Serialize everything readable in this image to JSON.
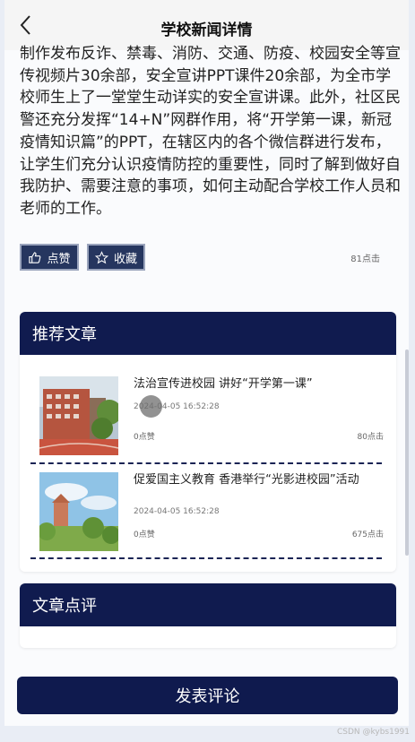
{
  "header": {
    "title": "学校新闻详情"
  },
  "article": {
    "body": "制作发布反诈、禁毒、消防、交通、防疫、校园安全等宣传视频片30余部，安全宣讲PPT课件20余部，为全市学校师生上了一堂堂生动详实的安全宣讲课。此外，社区民警还充分发挥“14+N”网群作用，将“开学第一课，新冠疫情知识篇”的PPT，在辖区内的各个微信群进行发布，让学生们充分认识疫情防控的重要性，同时了解到做好自我防护、需要注意的事项，如何主动配合学校工作人员和老师的工作。"
  },
  "actions": {
    "like_label": "点赞",
    "favorite_label": "收藏",
    "clicks": "81点击"
  },
  "recommended": {
    "heading": "推荐文章",
    "items": [
      {
        "title": "法治宣传进校园 讲好“开学第一课”",
        "date": "2024-04-05 16:52:28",
        "likes": "0点赞",
        "clicks": "80点击"
      },
      {
        "title": "促爱国主义教育 香港举行“光影进校园”活动",
        "date": "2024-04-05 16:52:28",
        "likes": "0点赞",
        "clicks": "675点击"
      }
    ]
  },
  "comments": {
    "heading": "文章点评"
  },
  "submit": {
    "label": "发表评论"
  },
  "watermark": "CSDN @kybs1991",
  "colors": {
    "header_bg": "#f5f5f5",
    "navy": "#101b4f",
    "button_bg": "#26365f"
  },
  "icons": {
    "back": "back-chevron-icon",
    "like": "thumbs-up-icon",
    "favorite": "star-icon"
  }
}
